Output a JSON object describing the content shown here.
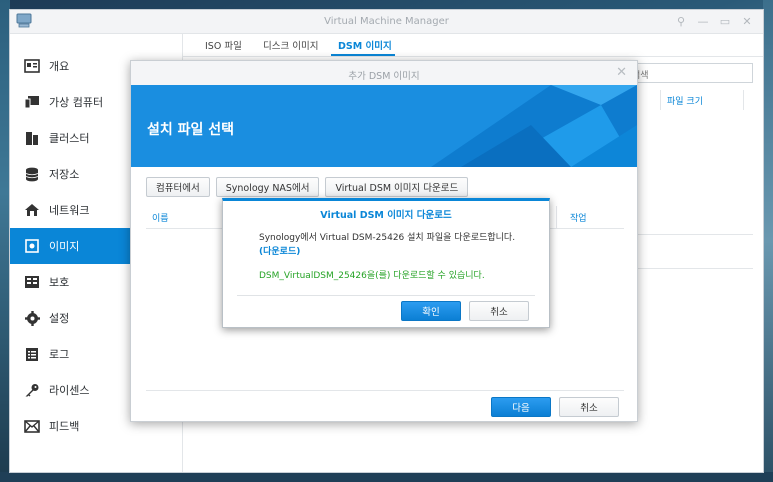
{
  "window": {
    "title": "Virtual Machine Manager",
    "controls": [
      "pin-icon",
      "minimize-icon",
      "maximize-icon",
      "close-icon"
    ]
  },
  "sidebar": {
    "items": [
      {
        "label": "개요",
        "icon": "overview-icon"
      },
      {
        "label": "가상 컴퓨터",
        "icon": "virtual-machine-icon"
      },
      {
        "label": "클러스터",
        "icon": "cluster-icon"
      },
      {
        "label": "저장소",
        "icon": "storage-icon"
      },
      {
        "label": "네트워크",
        "icon": "network-icon"
      },
      {
        "label": "이미지",
        "icon": "image-icon",
        "active": true
      },
      {
        "label": "보호",
        "icon": "protection-icon"
      },
      {
        "label": "설정",
        "icon": "settings-icon"
      },
      {
        "label": "로그",
        "icon": "log-icon"
      },
      {
        "label": "라이센스",
        "icon": "license-key-icon"
      },
      {
        "label": "피드백",
        "icon": "feedback-mail-icon"
      }
    ]
  },
  "tabs": [
    {
      "label": "ISO 파일"
    },
    {
      "label": "디스크 이미지"
    },
    {
      "label": "DSM 이미지",
      "active": true
    }
  ],
  "main": {
    "search_placeholder": "검색",
    "col_size": "파일 크기"
  },
  "add_dialog": {
    "title": "추가 DSM 이미지",
    "banner_title": "설치 파일 선택",
    "source_buttons": [
      "컴퓨터에서",
      "Synology NAS에서",
      "Virtual DSM 이미지 다운로드"
    ],
    "col_name": "이름",
    "col_action": "작업",
    "next_label": "다음",
    "cancel_label": "취소"
  },
  "download_dialog": {
    "title": "Virtual DSM 이미지 다운로드",
    "message": "Synology에서 Virtual DSM-25426 설치 파일을 다운로드합니다. ",
    "link": "(다운로드)",
    "status": "DSM_VirtualDSM_25426을(를) 다운로드할 수 있습니다.",
    "ok_label": "확인",
    "cancel_label": "취소"
  },
  "colors": {
    "accent": "#0a86d7",
    "success": "#26a326",
    "banner": "#1a8ee0"
  }
}
